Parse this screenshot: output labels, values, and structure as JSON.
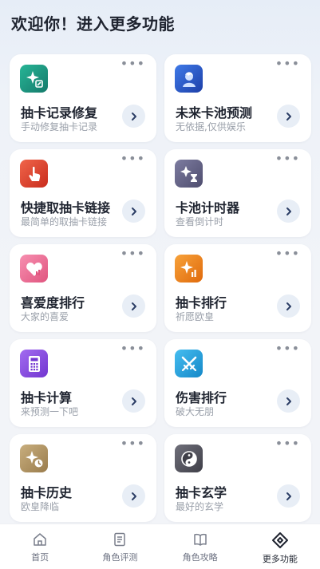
{
  "header": {
    "title": "欢迎你！进入更多功能"
  },
  "more_glyph": "•••",
  "cards": [
    {
      "title": "抽卡记录修复",
      "subtitle": "手动修复抽卡记录",
      "icon": "sparkle-edit-icon",
      "color": "#1f9e86"
    },
    {
      "title": "未来卡池预测",
      "subtitle": "无依据,仅供娱乐",
      "icon": "character-avatar-icon",
      "color": "#2f5fd0"
    },
    {
      "title": "快捷取抽卡链接",
      "subtitle": "最简单的取抽卡链接",
      "icon": "hand-tap-icon",
      "color": "#e0452e"
    },
    {
      "title": "卡池计时器",
      "subtitle": "查看倒计时",
      "icon": "sparkle-hourglass-icon",
      "color": "#6b6a8e"
    },
    {
      "title": "喜爱度排行",
      "subtitle": "大家的喜爱",
      "icon": "heart-chart-icon",
      "color": "#f0709a"
    },
    {
      "title": "抽卡排行",
      "subtitle": "祈愿欧皇",
      "icon": "sparkle-chart-icon",
      "color": "#f08a1c"
    },
    {
      "title": "抽卡计算",
      "subtitle": "来预测一下吧",
      "icon": "calculator-icon",
      "color": "#8a4fe0"
    },
    {
      "title": "伤害排行",
      "subtitle": "破大无朋",
      "icon": "crossed-swords-icon",
      "color": "#2aa3e0"
    },
    {
      "title": "抽卡历史",
      "subtitle": "欧皇降临",
      "icon": "sparkle-clock-icon",
      "color": "#b89a6a"
    },
    {
      "title": "抽卡玄学",
      "subtitle": "最好的玄学",
      "icon": "yin-yang-icon",
      "color": "#5a5a64"
    }
  ],
  "tabs": [
    {
      "label": "首页",
      "icon": "home-icon",
      "active": false
    },
    {
      "label": "角色评测",
      "icon": "document-icon",
      "active": false
    },
    {
      "label": "角色攻略",
      "icon": "book-icon",
      "active": false
    },
    {
      "label": "更多功能",
      "icon": "diamond-link-icon",
      "active": true
    }
  ]
}
